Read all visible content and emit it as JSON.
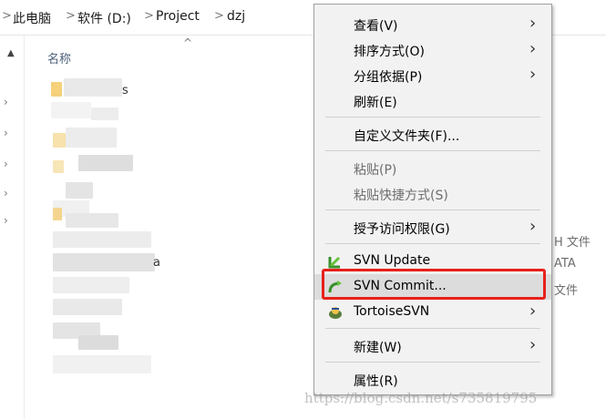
{
  "breadcrumb": {
    "items": [
      "此电脑",
      "软件 (D:)",
      "Project",
      "dzj"
    ],
    "separator": ">"
  },
  "file_list": {
    "column_header": "名称",
    "partial_names": [
      "s",
      "a"
    ]
  },
  "right_column_fragments": [
    "H 文件",
    "ATA",
    "文件"
  ],
  "context_menu": {
    "items": {
      "view": "查看(V)",
      "sort": "排序方式(O)",
      "group": "分组依据(P)",
      "refresh": "刷新(E)",
      "customize": "自定义文件夹(F)...",
      "paste": "粘贴(P)",
      "paste_shortcut": "粘贴快捷方式(S)",
      "grant_access": "授予访问权限(G)",
      "svn_update": "SVN Update",
      "svn_commit": "SVN Commit...",
      "tortoise": "TortoiseSVN",
      "new": "新建(W)",
      "properties": "属性(R)"
    },
    "highlighted_item": "SVN Commit..."
  },
  "colors": {
    "highlight_box": "#e8201a",
    "menu_background": "#f2f2f2",
    "disabled_text": "#6d6d6d"
  },
  "watermark": "https://blog.csdn.net/s735819795"
}
